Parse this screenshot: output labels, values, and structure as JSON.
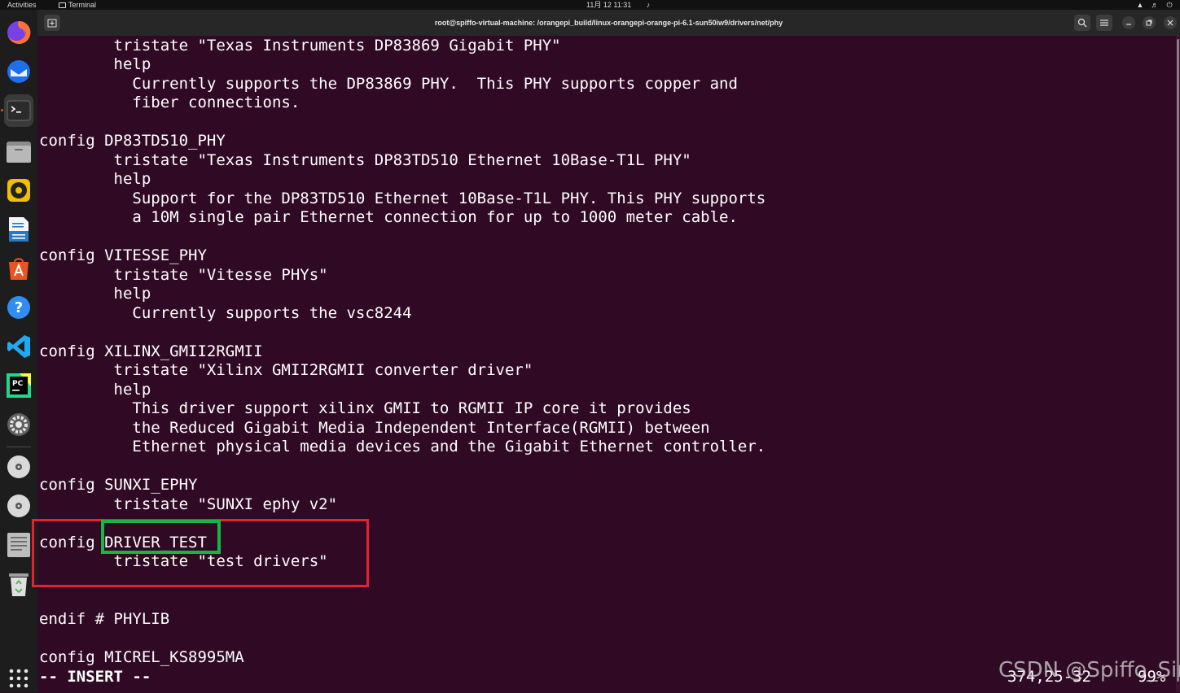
{
  "topbar": {
    "activities": "Activities",
    "app_name": "Terminal",
    "clock": "11月 12  11:31"
  },
  "window": {
    "title": "root@spiffo-virtual-machine: /orangepi_build/linux-orangepi-orange-pi-6.1-sun50iw9/drivers/net/phy"
  },
  "dock": {
    "items": [
      "firefox-icon",
      "thunderbird-icon",
      "terminal-icon",
      "files-icon",
      "rhythmbox-icon",
      "writer-icon",
      "app-center-icon",
      "help-icon",
      "vscode-icon",
      "pycharm-icon",
      "settings-icon",
      "disc-icon",
      "disc-icon-2",
      "text-editor-icon",
      "trash-icon",
      "show-apps-icon"
    ]
  },
  "editor": {
    "lines": [
      "        tristate \"Texas Instruments DP83869 Gigabit PHY\"",
      "        help",
      "          Currently supports the DP83869 PHY.  This PHY supports copper and",
      "          fiber connections.",
      "",
      "config DP83TD510_PHY",
      "        tristate \"Texas Instruments DP83TD510 Ethernet 10Base-T1L PHY\"",
      "        help",
      "          Support for the DP83TD510 Ethernet 10Base-T1L PHY. This PHY supports",
      "          a 10M single pair Ethernet connection for up to 1000 meter cable.",
      "",
      "config VITESSE_PHY",
      "        tristate \"Vitesse PHYs\"",
      "        help",
      "          Currently supports the vsc8244",
      "",
      "config XILINX_GMII2RGMII",
      "        tristate \"Xilinx GMII2RGMII converter driver\"",
      "        help",
      "          This driver support xilinx GMII to RGMII IP core it provides",
      "          the Reduced Gigabit Media Independent Interface(RGMII) between",
      "          Ethernet physical media devices and the Gigabit Ethernet controller.",
      "",
      "config SUNXI_EPHY",
      "        tristate \"SUNXI ephy v2\"",
      "",
      "config DRIVER_TEST",
      "        tristate \"test drivers\"",
      "",
      "",
      "endif # PHYLIB",
      "",
      "config MICREL_KS8995MA"
    ],
    "mode": "-- INSERT --",
    "position": "374,25-32",
    "percent": "99%"
  },
  "watermark": "CSDN @Spiffo_Sir",
  "colors": {
    "background": "#300a24",
    "highlight_red": "#e8202f",
    "highlight_green": "#16b545",
    "dock_indicator": "#e95420"
  }
}
